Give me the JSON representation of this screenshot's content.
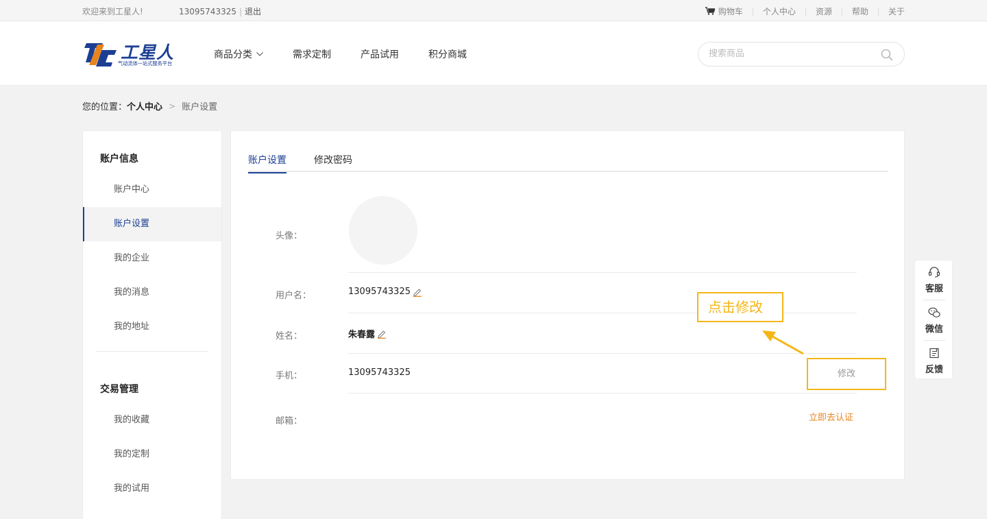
{
  "topbar": {
    "welcome": "欢迎来到工星人!",
    "phone": "13095743325",
    "separator": "|",
    "logout": "退出",
    "cart": "购物车",
    "links": [
      "个人中心",
      "资源",
      "帮助",
      "关于"
    ]
  },
  "header": {
    "brand": "工星人",
    "slogan": "气动流体一站式服务平台",
    "nav": [
      "商品分类",
      "需求定制",
      "产品试用",
      "积分商城"
    ],
    "search_placeholder": "搜索商品"
  },
  "breadcrumb": {
    "prefix": "您的位置：",
    "parent": "个人中心",
    "arrow": ">",
    "current": "账户设置"
  },
  "sidebar": {
    "group1": "账户信息",
    "group1_items": [
      "账户中心",
      "账户设置",
      "我的企业",
      "我的消息",
      "我的地址"
    ],
    "group2": "交易管理",
    "group2_items": [
      "我的收藏",
      "我的定制",
      "我的试用"
    ]
  },
  "main": {
    "tabs": [
      "账户设置",
      "修改密码"
    ],
    "avatar_label": "头像：",
    "username_label": "用户名：",
    "username_value": "13095743325",
    "name_label": "姓名：",
    "name_value": "朱春露",
    "phone_label": "手机：",
    "phone_value": "13095743325",
    "modify_label": "修改",
    "email_label": "邮箱：",
    "verify_label": "立即去认证"
  },
  "annotation": {
    "text": "点击修改"
  },
  "floatbar": {
    "items": [
      "客服",
      "微信",
      "反馈"
    ]
  },
  "colors": {
    "primary": "#1c3f94",
    "accent_orange": "#e8841b",
    "highlight": "#f5b617"
  }
}
